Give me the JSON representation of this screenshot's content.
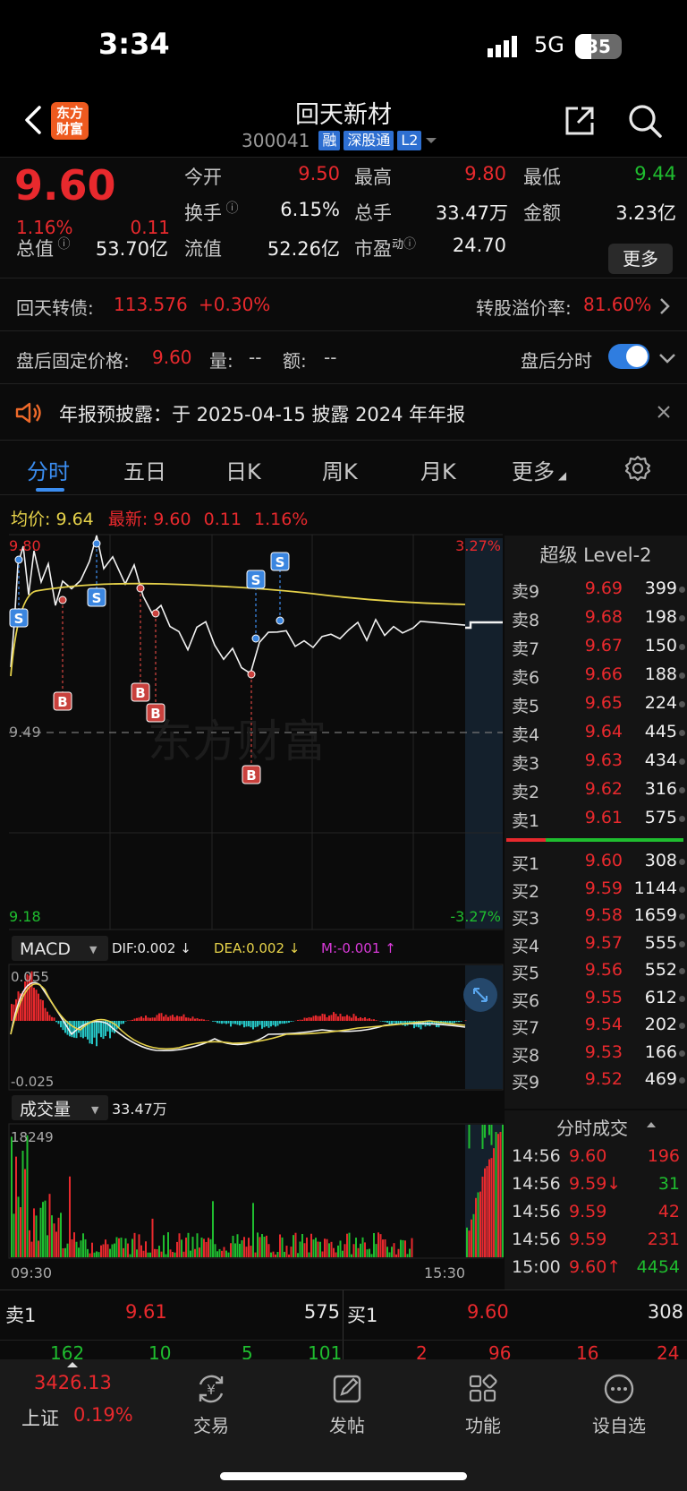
{
  "status_bar": {
    "time": "3:34",
    "network": "5G",
    "battery": "35"
  },
  "header": {
    "logo_text": "东方财富",
    "stock_name": "回天新材",
    "stock_code": "300041",
    "tags": [
      "融",
      "深股通",
      "L2"
    ]
  },
  "quote": {
    "last_price": "9.60",
    "change_pct": "1.16%",
    "change_amt": "0.11",
    "open_label": "今开",
    "open": "9.50",
    "high_label": "最高",
    "high": "9.80",
    "low_label": "最低",
    "low": "9.44",
    "turnover_label": "换手",
    "turnover": "6.15%",
    "volume_label": "总手",
    "volume": "33.47万",
    "amount_label": "金额",
    "amount": "3.23亿",
    "mktcap_label": "总值",
    "mktcap": "53.70亿",
    "float_label": "流值",
    "float_cap": "52.26亿",
    "pe_label": "市盈",
    "pe_sup": "动",
    "pe": "24.70",
    "more_label": "更多"
  },
  "bond": {
    "label": "回天转债:",
    "price": "113.576",
    "change": "+0.30%",
    "premium_label": "转股溢价率:",
    "premium": "81.60%"
  },
  "after_hours": {
    "label": "盘后固定价格:",
    "price": "9.60",
    "vol_label": "量:",
    "vol": "--",
    "amt_label": "额:",
    "amt": "--",
    "toggle_label": "盘后分时",
    "toggle_on": true
  },
  "notice": {
    "text": "年报预披露：于 2025-04-15 披露 2024 年年报"
  },
  "tabs": [
    "分时",
    "五日",
    "日K",
    "周K",
    "月K",
    "更多"
  ],
  "active_tab": "分时",
  "avg_line": {
    "avg_label": "均价:",
    "avg": "9.64",
    "latest_label": "最新:",
    "latest": "9.60",
    "chg": "0.11",
    "pct": "1.16%"
  },
  "chart_data": {
    "type": "line",
    "price_axis": {
      "top": "9.80",
      "bottom": "9.18",
      "ref": "9.49",
      "top_pct": "3.27%",
      "bottom_pct": "-3.27%"
    },
    "time_axis": {
      "start": "09:30",
      "end": "15:30"
    },
    "watermark": "东方财富",
    "markers": [
      {
        "kind": "S"
      },
      {
        "kind": "S"
      },
      {
        "kind": "B"
      },
      {
        "kind": "B"
      },
      {
        "kind": "B"
      },
      {
        "kind": "S"
      },
      {
        "kind": "S"
      },
      {
        "kind": "B"
      }
    ],
    "macd": {
      "label": "MACD",
      "dif_label": "DIF:0.002 ↓",
      "dea_label": "DEA:0.002 ↓",
      "m_label": "M:-0.001 ↑",
      "top": "0.055",
      "bottom": "-0.025"
    },
    "volume": {
      "label": "成交量",
      "total": "33.47万",
      "max": "18249"
    }
  },
  "order_book": {
    "title": "超级 Level-2",
    "asks": [
      {
        "label": "卖9",
        "price": "9.69",
        "vol": "399"
      },
      {
        "label": "卖8",
        "price": "9.68",
        "vol": "198"
      },
      {
        "label": "卖7",
        "price": "9.67",
        "vol": "150"
      },
      {
        "label": "卖6",
        "price": "9.66",
        "vol": "188"
      },
      {
        "label": "卖5",
        "price": "9.65",
        "vol": "224"
      },
      {
        "label": "卖4",
        "price": "9.64",
        "vol": "445"
      },
      {
        "label": "卖3",
        "price": "9.63",
        "vol": "434"
      },
      {
        "label": "卖2",
        "price": "9.62",
        "vol": "316"
      },
      {
        "label": "卖1",
        "price": "9.61",
        "vol": "575"
      }
    ],
    "bids": [
      {
        "label": "买1",
        "price": "9.60",
        "vol": "308"
      },
      {
        "label": "买2",
        "price": "9.59",
        "vol": "1144"
      },
      {
        "label": "买3",
        "price": "9.58",
        "vol": "1659"
      },
      {
        "label": "买4",
        "price": "9.57",
        "vol": "555"
      },
      {
        "label": "买5",
        "price": "9.56",
        "vol": "552"
      },
      {
        "label": "买6",
        "price": "9.55",
        "vol": "612"
      },
      {
        "label": "买7",
        "price": "9.54",
        "vol": "202"
      },
      {
        "label": "买8",
        "price": "9.53",
        "vol": "166"
      },
      {
        "label": "买9",
        "price": "9.52",
        "vol": "469"
      }
    ]
  },
  "trades": {
    "title": "分时成交",
    "rows": [
      {
        "time": "14:56",
        "price": "9.60",
        "vol": "196",
        "color": "red"
      },
      {
        "time": "14:56",
        "price": "9.59↓",
        "vol": "31",
        "color": "green"
      },
      {
        "time": "14:56",
        "price": "9.59",
        "vol": "42",
        "color": "red"
      },
      {
        "time": "14:56",
        "price": "9.59",
        "vol": "231",
        "color": "red"
      },
      {
        "time": "15:00",
        "price": "9.60↑",
        "vol": "4454",
        "color": "green"
      }
    ]
  },
  "bottom_strip": {
    "ask_label": "卖1",
    "ask_price": "9.61",
    "ask_vol": "575",
    "bid_label": "买1",
    "bid_price": "9.60",
    "bid_vol": "308",
    "ask_details": [
      "162",
      "10",
      "5",
      "101"
    ],
    "bid_details": [
      "2",
      "96",
      "16",
      "24"
    ]
  },
  "bottom_nav": {
    "index_value": "3426.13",
    "index_name": "上证",
    "index_pct": "0.19%",
    "items": [
      "交易",
      "发帖",
      "功能",
      "设自选"
    ]
  }
}
